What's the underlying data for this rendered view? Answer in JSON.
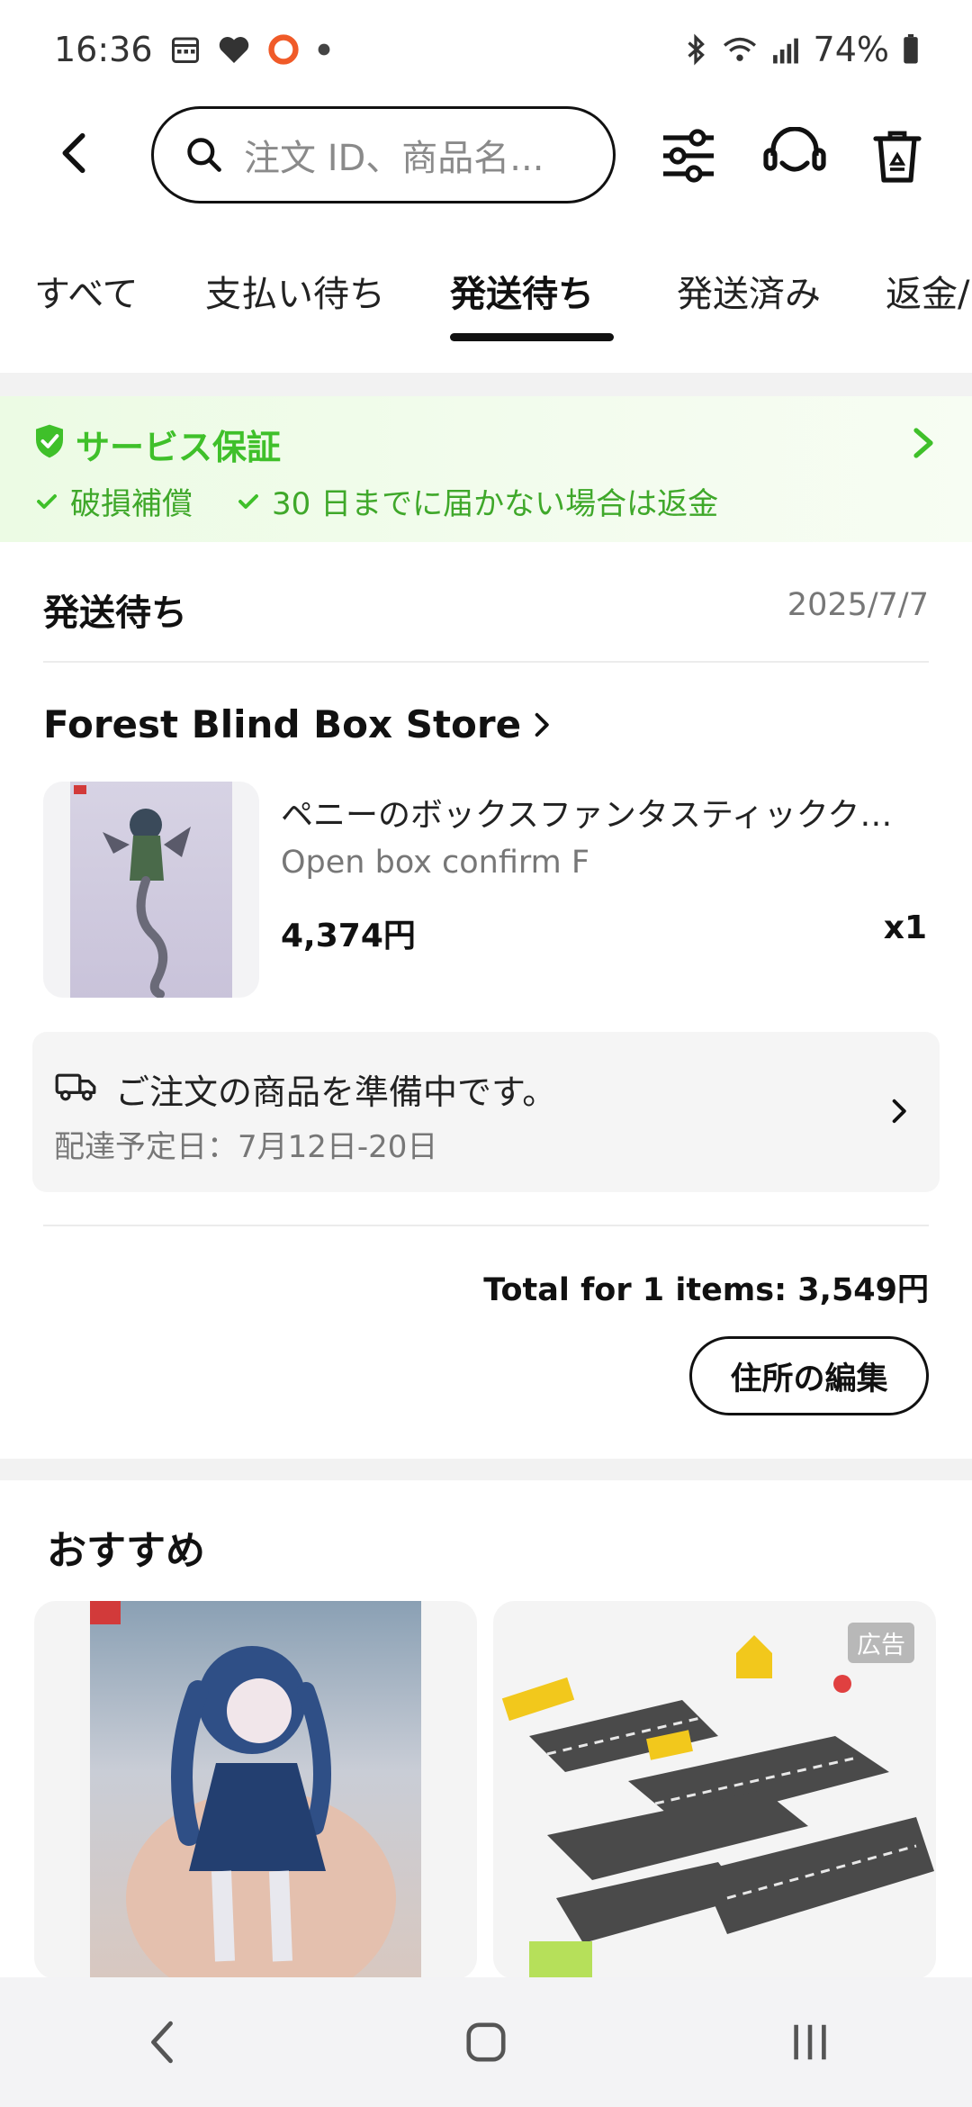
{
  "status_bar": {
    "time": "16:36",
    "battery": "74%"
  },
  "header": {
    "search_placeholder": "注文 ID、商品名..."
  },
  "tabs": [
    {
      "label": "すべて"
    },
    {
      "label": "支払い待ち"
    },
    {
      "label": "発送待ち"
    },
    {
      "label": "発送済み"
    },
    {
      "label": "返金/"
    }
  ],
  "active_tab": "発送待ち",
  "service": {
    "title": "サービス保証",
    "items": [
      "破損補償",
      "30 日までに届かない場合は返金"
    ]
  },
  "order": {
    "status": "発送待ち",
    "date": "2025/7/7",
    "store": "Forest Blind Box Store",
    "product_title": "ペニーのボックスファンタスティッククリー...",
    "variant": "Open box confirm F",
    "price": "4,374円",
    "quantity": "x1",
    "shipping_message": "ご注文の商品を準備中です。",
    "delivery_estimate": "配達予定日：7月12日-20日",
    "total": "Total for 1 items: 3,549円",
    "edit_address": "住所の編集"
  },
  "recommendations": {
    "title": "おすすめ",
    "ad_badge": "広告"
  },
  "colors": {
    "accent_green": "#3fc02a",
    "text": "#111111",
    "muted": "#777777"
  }
}
